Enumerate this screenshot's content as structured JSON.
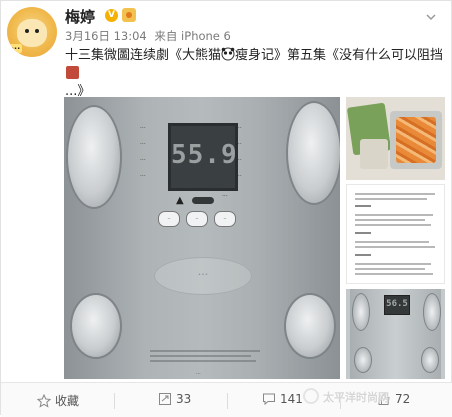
{
  "post": {
    "author": "梅婷",
    "vip_label": "V",
    "time": "3月16日 13:04",
    "source": "来自 iPhone 6",
    "content_line1": "十三集微圖连续劇《大熊猫",
    "content_line1b": "瘦身记》第五集《没有什么可以阻挡",
    "content_line2": "...》",
    "main_scale_reading": "55.9",
    "thumb_scale_reading": "56.5"
  },
  "footer": {
    "collect": "收藏",
    "repost": "33",
    "comment": "141",
    "like": "72"
  },
  "watermark": "太平洋时尚网",
  "colors": {
    "accent": "#f5b000",
    "icon": "#888888"
  }
}
